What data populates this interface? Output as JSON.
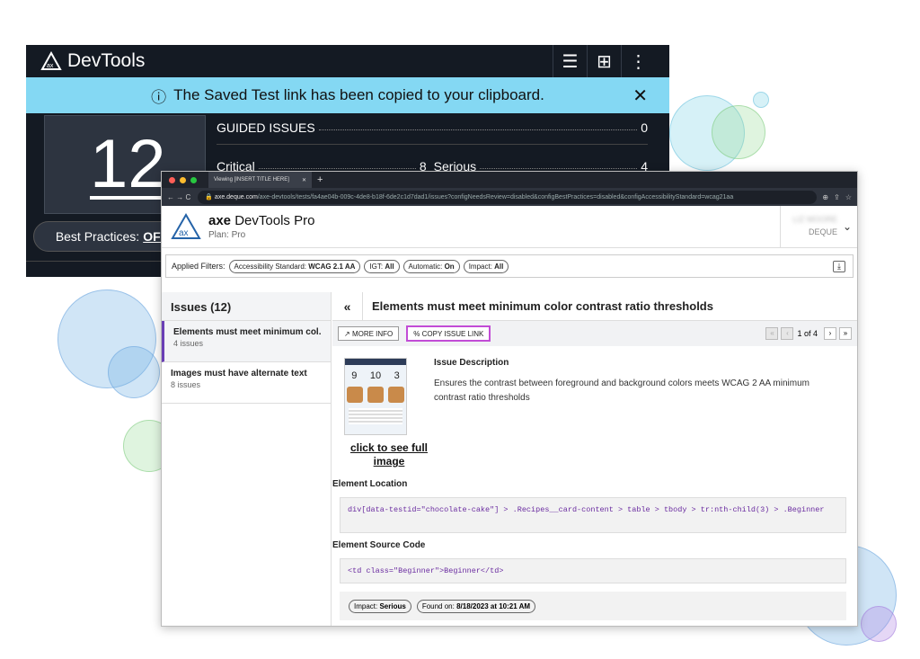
{
  "devtools": {
    "title": "DevTools",
    "banner": "The Saved Test link has been copied to your clipboard.",
    "score": "12",
    "guided_issues_label": "GUIDED ISSUES",
    "guided_issues_count": "0",
    "critical_label": "Critical",
    "critical_count": "8",
    "serious_label": "Serious",
    "serious_count": "4",
    "best_practices_label": "Best Practices:",
    "best_practices_value": "OFF"
  },
  "browser": {
    "tab_title": "Viewing [INSERT TITLE HERE]",
    "url_domain": "axe.deque.com",
    "url_path": "/axe-devtools/tests/fa4ae04b-009c-4de8-b18f-6de2c1d7dad1/issues?configNeedsReview=disabled&configBestPractices=disabled&configAccessibilityStandard=wcag21aa"
  },
  "app": {
    "name_bold": "axe",
    "name_rest": "DevTools Pro",
    "plan": "Plan: Pro",
    "user_name": "LIZ MOORE",
    "org": "DEQUE"
  },
  "filters": {
    "label": "Applied Filters:",
    "items": [
      {
        "key": "Accessibility Standard:",
        "value": "WCAG 2.1 AA"
      },
      {
        "key": "IGT:",
        "value": "All"
      },
      {
        "key": "Automatic:",
        "value": "On"
      },
      {
        "key": "Impact:",
        "value": "All"
      }
    ]
  },
  "issues": {
    "header": "Issues (12)",
    "items": [
      {
        "title": "Elements must meet minimum col...",
        "count": "4 issues"
      },
      {
        "title": "Images must have alternate text",
        "count": "8 issues"
      }
    ]
  },
  "detail": {
    "title": "Elements must meet minimum color contrast ratio thresholds",
    "more_info": "MORE INFO",
    "copy_link": "COPY ISSUE LINK",
    "pager": "1 of 4",
    "thumb_nums": [
      "9",
      "10",
      "3"
    ],
    "see_full": "click to see full image",
    "desc_title": "Issue Description",
    "desc_text": "Ensures the contrast between foreground and background colors meets WCAG 2 AA minimum contrast ratio thresholds",
    "location_title": "Element Location",
    "location_code": "div[data-testid=\"chocolate-cake\"] > .Recipes__card-content > table > tbody > tr:nth-child(3) > .Beginner",
    "source_title": "Element Source Code",
    "source_code": "<td class=\"Beginner\">Beginner</td>",
    "impact_label": "Impact:",
    "impact_value": "Serious",
    "found_label": "Found on:",
    "found_value": "8/18/2023 at 10:21 AM"
  },
  "colors": {
    "banner": "#84d8f3",
    "accent": "#c24cd6",
    "dark": "#141a23"
  }
}
